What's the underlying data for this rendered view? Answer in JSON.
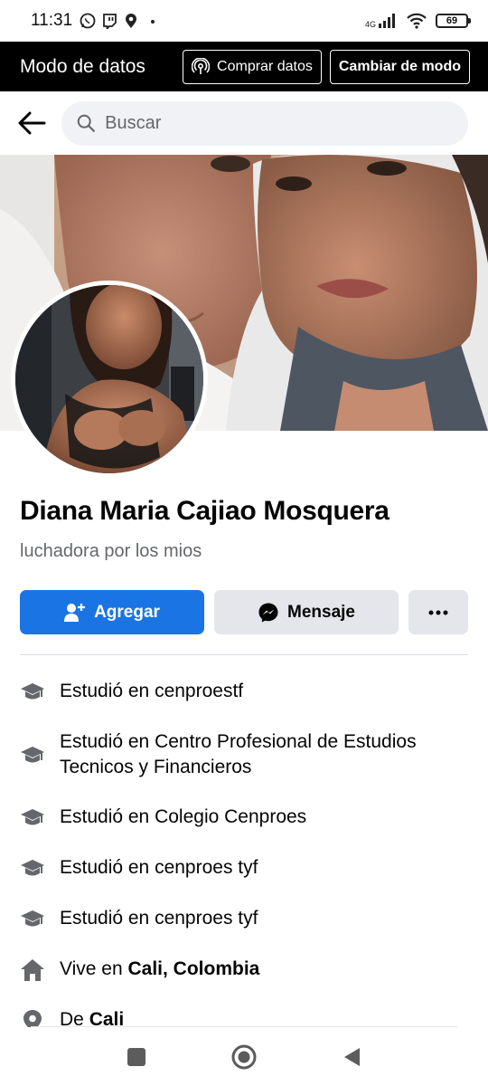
{
  "status_bar": {
    "time": "11:31",
    "network": "4G",
    "battery": "69",
    "left_icons": [
      "whatsapp-icon",
      "twitch-icon",
      "location-icon",
      "dot-icon"
    ],
    "right_icons": [
      "signal-icon",
      "wifi-icon",
      "battery-icon"
    ]
  },
  "data_mode_bar": {
    "title": "Modo de datos",
    "buy_button": "Comprar datos",
    "change_button": "Cambiar de modo"
  },
  "search": {
    "placeholder": "Buscar"
  },
  "profile": {
    "name": "Diana Maria Cajiao Mosquera",
    "bio": "luchadora por los mios",
    "add_button": "Agregar",
    "message_button": "Mensaje",
    "more_button": "•••"
  },
  "details": [
    {
      "icon": "graduation-cap-icon",
      "prefix": "Estudió en cenproestf",
      "bold": ""
    },
    {
      "icon": "graduation-cap-icon",
      "prefix": "Estudió en Centro Profesional de Estudios Tecnicos y Financieros",
      "bold": ""
    },
    {
      "icon": "graduation-cap-icon",
      "prefix": "Estudió en Colegio Cenproes",
      "bold": ""
    },
    {
      "icon": "graduation-cap-icon",
      "prefix": "Estudió en cenproes tyf",
      "bold": ""
    },
    {
      "icon": "graduation-cap-icon",
      "prefix": "Estudió en cenproes tyf",
      "bold": ""
    },
    {
      "icon": "home-icon",
      "prefix": "Vive en ",
      "bold": "Cali, Colombia"
    },
    {
      "icon": "location-pin-icon",
      "prefix": "De ",
      "bold": "Cali"
    }
  ],
  "nav_bar": {
    "buttons": [
      "recent-apps-button",
      "home-button",
      "back-button"
    ]
  },
  "colors": {
    "accent": "#1b74e4",
    "button_gray": "#e4e6eb",
    "secondary_text": "#65676b",
    "data_bar": "#000000"
  }
}
